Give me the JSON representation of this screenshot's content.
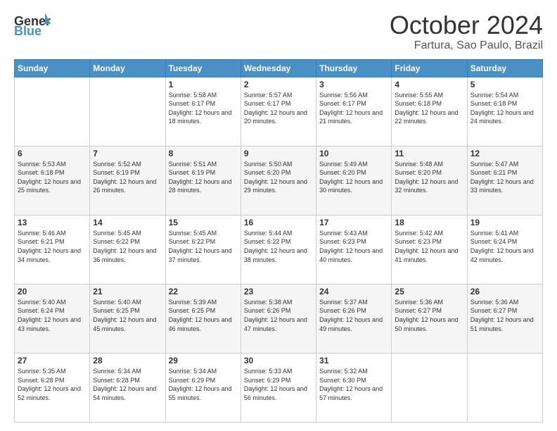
{
  "logo": {
    "text_general": "General",
    "text_blue": "Blue"
  },
  "title": "October 2024",
  "location": "Fartura, Sao Paulo, Brazil",
  "days_of_week": [
    "Sunday",
    "Monday",
    "Tuesday",
    "Wednesday",
    "Thursday",
    "Friday",
    "Saturday"
  ],
  "weeks": [
    [
      {
        "day": "",
        "info": ""
      },
      {
        "day": "",
        "info": ""
      },
      {
        "day": "1",
        "info": "Sunrise: 5:58 AM\nSunset: 6:17 PM\nDaylight: 12 hours and 18 minutes."
      },
      {
        "day": "2",
        "info": "Sunrise: 5:57 AM\nSunset: 6:17 PM\nDaylight: 12 hours and 20 minutes."
      },
      {
        "day": "3",
        "info": "Sunrise: 5:56 AM\nSunset: 6:17 PM\nDaylight: 12 hours and 21 minutes."
      },
      {
        "day": "4",
        "info": "Sunrise: 5:55 AM\nSunset: 6:18 PM\nDaylight: 12 hours and 22 minutes."
      },
      {
        "day": "5",
        "info": "Sunrise: 5:54 AM\nSunset: 6:18 PM\nDaylight: 12 hours and 24 minutes."
      }
    ],
    [
      {
        "day": "6",
        "info": "Sunrise: 5:53 AM\nSunset: 6:18 PM\nDaylight: 12 hours and 25 minutes."
      },
      {
        "day": "7",
        "info": "Sunrise: 5:52 AM\nSunset: 6:19 PM\nDaylight: 12 hours and 26 minutes."
      },
      {
        "day": "8",
        "info": "Sunrise: 5:51 AM\nSunset: 6:19 PM\nDaylight: 12 hours and 28 minutes."
      },
      {
        "day": "9",
        "info": "Sunrise: 5:50 AM\nSunset: 6:20 PM\nDaylight: 12 hours and 29 minutes."
      },
      {
        "day": "10",
        "info": "Sunrise: 5:49 AM\nSunset: 6:20 PM\nDaylight: 12 hours and 30 minutes."
      },
      {
        "day": "11",
        "info": "Sunrise: 5:48 AM\nSunset: 6:20 PM\nDaylight: 12 hours and 32 minutes."
      },
      {
        "day": "12",
        "info": "Sunrise: 5:47 AM\nSunset: 6:21 PM\nDaylight: 12 hours and 33 minutes."
      }
    ],
    [
      {
        "day": "13",
        "info": "Sunrise: 5:46 AM\nSunset: 6:21 PM\nDaylight: 12 hours and 34 minutes."
      },
      {
        "day": "14",
        "info": "Sunrise: 5:45 AM\nSunset: 6:22 PM\nDaylight: 12 hours and 36 minutes."
      },
      {
        "day": "15",
        "info": "Sunrise: 5:45 AM\nSunset: 6:22 PM\nDaylight: 12 hours and 37 minutes."
      },
      {
        "day": "16",
        "info": "Sunrise: 5:44 AM\nSunset: 6:22 PM\nDaylight: 12 hours and 38 minutes."
      },
      {
        "day": "17",
        "info": "Sunrise: 5:43 AM\nSunset: 6:23 PM\nDaylight: 12 hours and 40 minutes."
      },
      {
        "day": "18",
        "info": "Sunrise: 5:42 AM\nSunset: 6:23 PM\nDaylight: 12 hours and 41 minutes."
      },
      {
        "day": "19",
        "info": "Sunrise: 5:41 AM\nSunset: 6:24 PM\nDaylight: 12 hours and 42 minutes."
      }
    ],
    [
      {
        "day": "20",
        "info": "Sunrise: 5:40 AM\nSunset: 6:24 PM\nDaylight: 12 hours and 43 minutes."
      },
      {
        "day": "21",
        "info": "Sunrise: 5:40 AM\nSunset: 6:25 PM\nDaylight: 12 hours and 45 minutes."
      },
      {
        "day": "22",
        "info": "Sunrise: 5:39 AM\nSunset: 6:25 PM\nDaylight: 12 hours and 46 minutes."
      },
      {
        "day": "23",
        "info": "Sunrise: 5:38 AM\nSunset: 6:26 PM\nDaylight: 12 hours and 47 minutes."
      },
      {
        "day": "24",
        "info": "Sunrise: 5:37 AM\nSunset: 6:26 PM\nDaylight: 12 hours and 49 minutes."
      },
      {
        "day": "25",
        "info": "Sunrise: 5:36 AM\nSunset: 6:27 PM\nDaylight: 12 hours and 50 minutes."
      },
      {
        "day": "26",
        "info": "Sunrise: 5:36 AM\nSunset: 6:27 PM\nDaylight: 12 hours and 51 minutes."
      }
    ],
    [
      {
        "day": "27",
        "info": "Sunrise: 5:35 AM\nSunset: 6:28 PM\nDaylight: 12 hours and 52 minutes."
      },
      {
        "day": "28",
        "info": "Sunrise: 5:34 AM\nSunset: 6:28 PM\nDaylight: 12 hours and 54 minutes."
      },
      {
        "day": "29",
        "info": "Sunrise: 5:34 AM\nSunset: 6:29 PM\nDaylight: 12 hours and 55 minutes."
      },
      {
        "day": "30",
        "info": "Sunrise: 5:33 AM\nSunset: 6:29 PM\nDaylight: 12 hours and 56 minutes."
      },
      {
        "day": "31",
        "info": "Sunrise: 5:32 AM\nSunset: 6:30 PM\nDaylight: 12 hours and 57 minutes."
      },
      {
        "day": "",
        "info": ""
      },
      {
        "day": "",
        "info": ""
      }
    ]
  ]
}
